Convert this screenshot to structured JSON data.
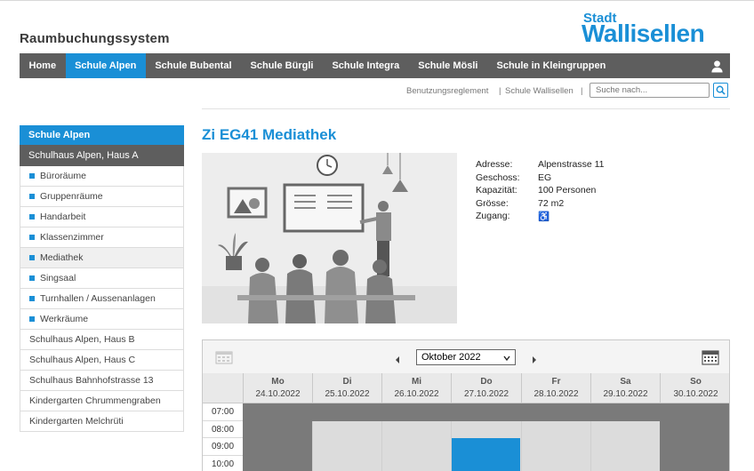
{
  "header": {
    "app_title": "Raumbuchungssystem",
    "logo_small": "Stadt",
    "logo_big": "Wallisellen",
    "brand_color": "#1a8fd6",
    "nav_color": "#5e5e5e"
  },
  "nav": {
    "items": [
      {
        "label": "Home",
        "active": false
      },
      {
        "label": "Schule Alpen",
        "active": true
      },
      {
        "label": "Schule Bubental",
        "active": false
      },
      {
        "label": "Schule Bürgli",
        "active": false
      },
      {
        "label": "Schule Integra",
        "active": false
      },
      {
        "label": "Schule Mösli",
        "active": false
      },
      {
        "label": "Schule in Kleingruppen",
        "active": false
      }
    ],
    "user_icon": "user-icon"
  },
  "utility": {
    "link1": "Benutzungsreglement",
    "sep1": "|",
    "link2": "Schule Wallisellen",
    "sep2": "|",
    "search_placeholder": "Suche nach...",
    "search_icon": "search-icon"
  },
  "sidebar": {
    "heading": "Schule Alpen",
    "subheading": "Schulhaus Alpen, Haus A",
    "children": [
      "Büroräume",
      "Gruppenräume",
      "Handarbeit",
      "Klassenzimmer",
      "Mediathek",
      "Singsaal",
      "Turnhallen / Aussenanlagen",
      "Werkräume"
    ],
    "selected_child": "Mediathek",
    "others": [
      "Schulhaus Alpen, Haus B",
      "Schulhaus Alpen, Haus C",
      "Schulhaus Bahnhofstrasse 13",
      "Kindergarten Chrummengraben",
      "Kindergarten Melchrüti"
    ]
  },
  "room": {
    "title": "Zi EG41 Mediathek",
    "details": [
      {
        "label": "Adresse:",
        "value": "Alpenstrasse 11"
      },
      {
        "label": "Geschoss:",
        "value": "EG"
      },
      {
        "label": "Kapazität:",
        "value": "100 Personen"
      },
      {
        "label": "Grösse:",
        "value": "72 m2"
      },
      {
        "label": "Zugang:",
        "value": "♿"
      }
    ]
  },
  "calendar": {
    "month": "Oktober 2022",
    "prev_icon": "chevron-left-icon",
    "next_icon": "chevron-right-icon",
    "days": [
      {
        "name": "Mo",
        "date": "24.10.2022"
      },
      {
        "name": "Di",
        "date": "25.10.2022"
      },
      {
        "name": "Mi",
        "date": "26.10.2022"
      },
      {
        "name": "Do",
        "date": "27.10.2022"
      },
      {
        "name": "Fr",
        "date": "28.10.2022"
      },
      {
        "name": "Sa",
        "date": "29.10.2022"
      },
      {
        "name": "So",
        "date": "30.10.2022"
      }
    ],
    "times": [
      "07:00",
      "08:00",
      "09:00",
      "10:00"
    ],
    "booking": {
      "day": "Do",
      "from": "09:00",
      "to": "10:00+"
    },
    "colors": {
      "unavailable": "#7a7a7a",
      "available": "#dcdcdc",
      "booked": "#1a8fd6"
    }
  }
}
